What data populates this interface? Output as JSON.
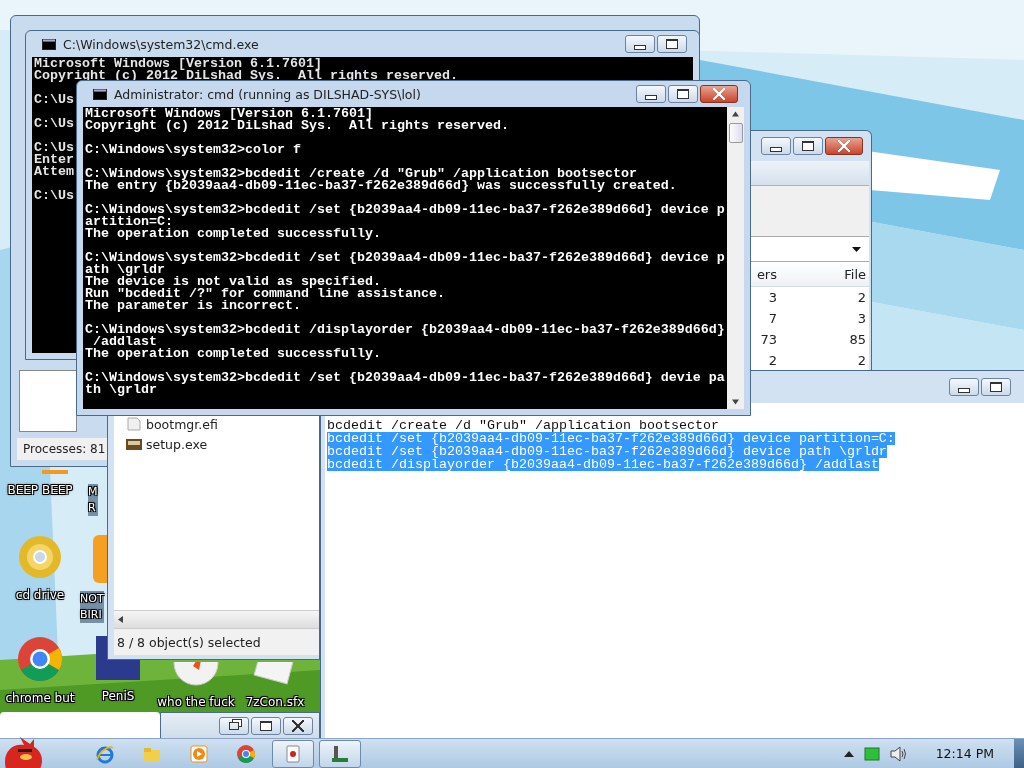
{
  "task_manager": {
    "status": "Processes: 81"
  },
  "console": {
    "title": "C:\\Windows\\system32\\cmd.exe",
    "blocks": [
      [
        "Microsoft Windows [Version 6.1.7601]",
        "Copyright (c) 2012 DiLshad Sys.  All rights reserved."
      ],
      [
        "C:\\Us"
      ],
      [
        "C:\\Us"
      ],
      [
        "C:\\Us",
        "Enter",
        "Attem"
      ],
      [
        "C:\\Us"
      ]
    ]
  },
  "explorer": {
    "columns": [
      "ers",
      "File"
    ],
    "rows": [
      [
        "3",
        "2"
      ],
      [
        "7",
        "3"
      ],
      [
        "73",
        "85"
      ],
      [
        "2",
        "2"
      ]
    ]
  },
  "file_window": {
    "files": [
      {
        "name": "bootmgr.efi",
        "kind": "file"
      },
      {
        "name": "setup.exe",
        "kind": "setup"
      }
    ],
    "status": "8 / 8 object(s) selected"
  },
  "notepad": {
    "lines": [
      {
        "text": "bcdedit /create /d \"Grub\" /application bootsector",
        "selected": false
      },
      {
        "text": "bcdedit /set {b2039aa4-db09-11ec-ba37-f262e389d66d} device partition=C:",
        "selected": true
      },
      {
        "text": "bcdedit /set {b2039aa4-db09-11ec-ba37-f262e389d66d} device path \\grldr",
        "selected": true
      },
      {
        "text": "bcdedit /displayorder {b2039aa4-db09-11ec-ba37-f262e389d66d} /addlast",
        "selected": true
      }
    ]
  },
  "admin_console": {
    "title": "Administrator: cmd (running as DILSHAD-SYS\\lol)",
    "blocks": [
      [
        "Microsoft Windows [Version 6.1.7601]",
        "Copyright (c) 2012 DiLshad Sys.  All rights reserved."
      ],
      [
        "C:\\Windows\\system32>color f"
      ],
      [
        "C:\\Windows\\system32>bcdedit /create /d \"Grub\" /application bootsector",
        "The entry {b2039aa4-db09-11ec-ba37-f262e389d66d} was successfully created."
      ],
      [
        "C:\\Windows\\system32>bcdedit /set {b2039aa4-db09-11ec-ba37-f262e389d66d} device p",
        "artition=C:",
        "The operation completed successfully."
      ],
      [
        "C:\\Windows\\system32>bcdedit /set {b2039aa4-db09-11ec-ba37-f262e389d66d} device p",
        "ath \\grldr",
        "The device is not valid as specified.",
        "Run \"bcdedit /?\" for command line assistance.",
        "The parameter is incorrect."
      ],
      [
        "C:\\Windows\\system32>bcdedit /displayorder {b2039aa4-db09-11ec-ba37-f262e389d66d}",
        " /addlast",
        "The operation completed successfully."
      ],
      [
        "C:\\Windows\\system32>bcdedit /set {b2039aa4-db09-11ec-ba37-f262e389d66d} devie pa",
        "th \\grldr"
      ]
    ]
  },
  "desktop_icons": [
    {
      "kind": "beep",
      "label": [
        "BEEP BEEP"
      ]
    },
    {
      "kind": "partial",
      "label": [
        "M",
        "R"
      ]
    },
    {
      "kind": "disc",
      "label": [
        "cd drive"
      ]
    },
    {
      "kind": "bird",
      "label": [
        "NOT",
        "BIRI"
      ]
    },
    {
      "kind": "chrome",
      "label": [
        "chrome but"
      ]
    },
    {
      "kind": "ps",
      "label": [
        "PeniS"
      ]
    },
    {
      "kind": "compass",
      "label": [
        "who the fuck"
      ]
    },
    {
      "kind": "archive",
      "label": [
        "7zCon.sfx"
      ]
    }
  ],
  "taskbar": {
    "apps": [
      {
        "kind": "ie",
        "active": false
      },
      {
        "kind": "folder",
        "active": false
      },
      {
        "kind": "media",
        "active": false
      },
      {
        "kind": "chrome",
        "active": false
      },
      {
        "kind": "cards",
        "active": true
      },
      {
        "kind": "tool",
        "active": true
      }
    ],
    "clock": "12:14 PM"
  }
}
